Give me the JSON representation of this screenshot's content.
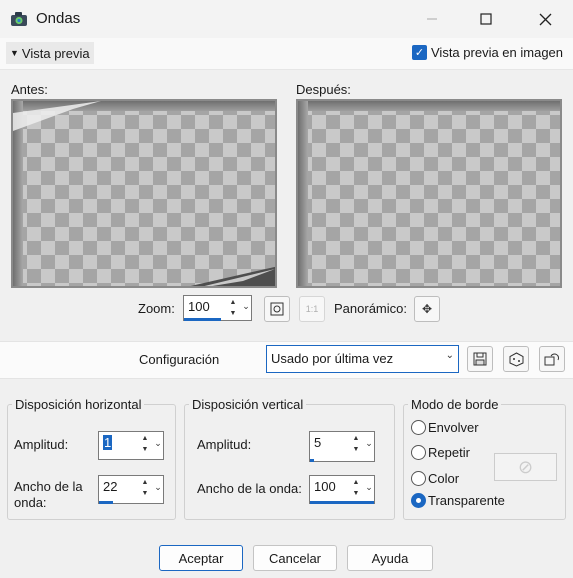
{
  "window": {
    "title": "Ondas",
    "min_icon": "minimize-icon",
    "max_icon": "maximize-icon",
    "close_icon": "close-icon"
  },
  "header": {
    "toggle_label": "Vista previa",
    "preview_checkbox_label": "Vista previa en imagen",
    "preview_checked": true
  },
  "preview": {
    "before_label": "Antes:",
    "after_label": "Después:"
  },
  "zoom": {
    "label": "Zoom:",
    "value": "100",
    "fill_fraction": 0.55,
    "panoramic_label": "Panorámico:"
  },
  "config": {
    "label": "Configuración",
    "selected": "Usado por última vez"
  },
  "horizontal": {
    "title": "Disposición horizontal",
    "amplitude_label": "Amplitud:",
    "amplitude_value": "1",
    "wavelength_label_1": "Ancho de la",
    "wavelength_label_2": "onda:",
    "wavelength_value": "22"
  },
  "vertical": {
    "title": "Disposición vertical",
    "amplitude_label": "Amplitud:",
    "amplitude_value": "5",
    "wavelength_label": "Ancho de la onda:",
    "wavelength_value": "100"
  },
  "border": {
    "title": "Modo de borde",
    "options": [
      "Envolver",
      "Repetir",
      "Color",
      "Transparente"
    ],
    "selected": "Transparente"
  },
  "buttons": {
    "ok": "Aceptar",
    "cancel": "Cancelar",
    "help": "Ayuda"
  },
  "colors": {
    "accent": "#1b67c2"
  }
}
